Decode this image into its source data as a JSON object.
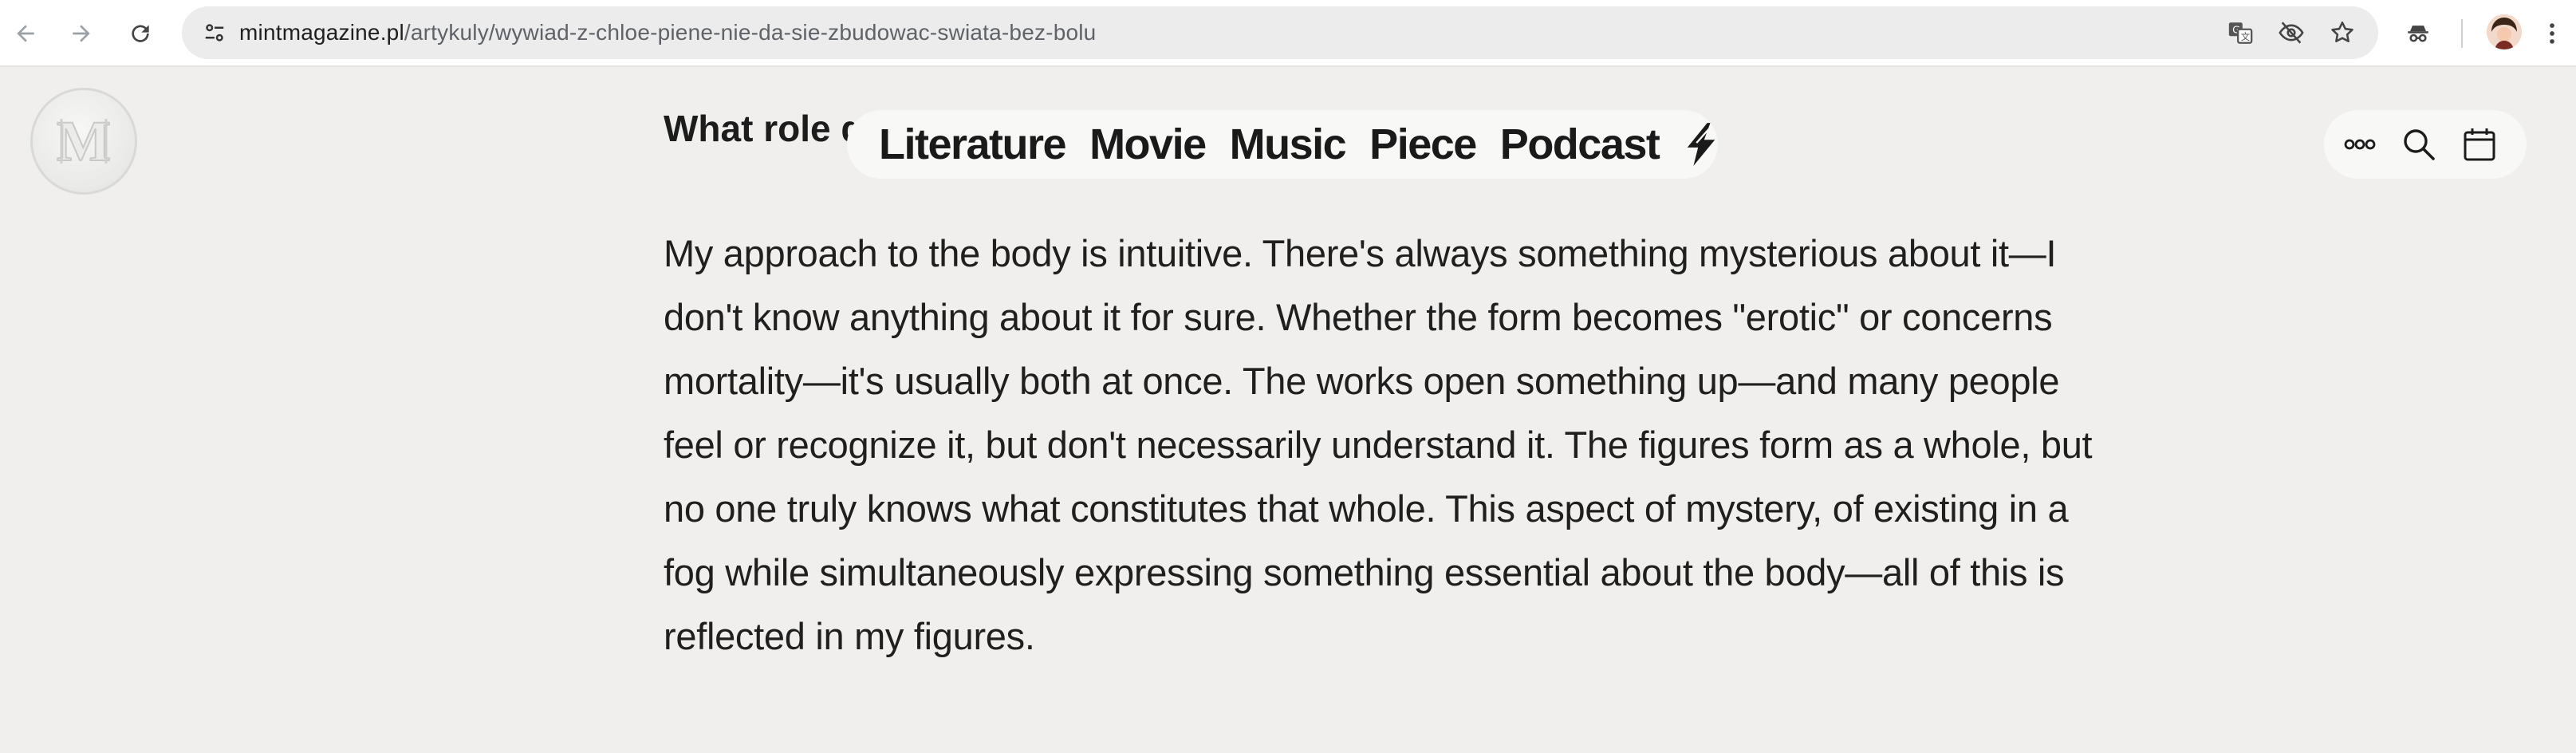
{
  "browser": {
    "url_host": "mintmagazine.pl",
    "url_path": "/artykuly/wywiad-z-chloe-piene-nie-da-sie-zbudowac-swiata-bez-bolu",
    "icons": {
      "back": "arrow-left-icon",
      "forward": "arrow-right-icon",
      "reload": "reload-icon",
      "site_info": "tune-icon",
      "translate": "translate-icon",
      "eye_off": "eye-off-icon",
      "bookmark": "star-icon",
      "incognito": "incognito-icon",
      "menu": "kebab-menu-icon"
    }
  },
  "site": {
    "logo_letter": "M",
    "nav": {
      "items": [
        "Literature",
        "Movie",
        "Music",
        "Piece",
        "Podcast"
      ],
      "bolt_icon": "lightning-icon"
    },
    "tools": [
      "more-icon",
      "search-icon",
      "calendar-icon"
    ]
  },
  "article": {
    "question_visible": "What role d",
    "paragraph": "My approach to the body is intuitive. There's always something mysterious about it—I don't know anything about it for sure. Whether the form becomes \"erotic\" or concerns mortality—it's usually both at once. The works open something up—and many people feel or recognize it, but don't necessarily understand it. The figures form as a whole, but no one truly knows what constitutes that whole. This aspect of mystery, of existing in a fog while simultaneously expressing something essential about the body—all of this is reflected in my figures."
  },
  "colors": {
    "page_bg": "#f0efed",
    "pill_bg": "#f8f8f7",
    "text": "#1c1c1c"
  }
}
